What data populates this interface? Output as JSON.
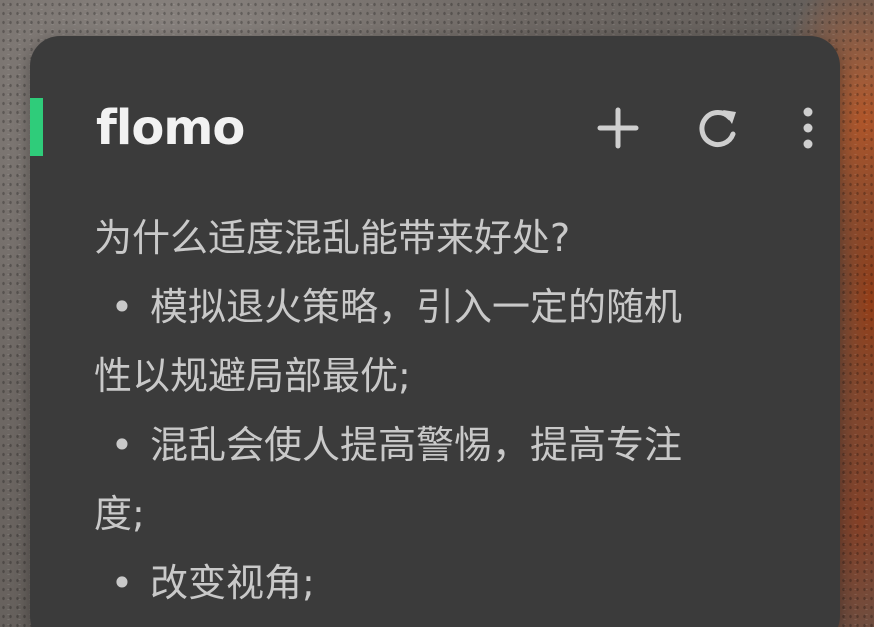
{
  "app": {
    "title": "flomo",
    "accent_color": "#2fcc7a",
    "card_color": "#3b3b3b"
  },
  "toolbar": {
    "add_icon": "plus-icon",
    "refresh_icon": "refresh-icon",
    "more_icon": "more-vertical-icon"
  },
  "memo": {
    "lines": [
      {
        "bullet": "",
        "text": "为什么适度混乱能带来好处?"
      },
      {
        "bullet": "•",
        "text": "模拟退火策略，引入一定的随机"
      },
      {
        "bullet": "",
        "text": "性以规避局部最优;"
      },
      {
        "bullet": "•",
        "text": "混乱会使人提高警惕，提高专注"
      },
      {
        "bullet": "",
        "text": "度;"
      },
      {
        "bullet": "•",
        "text": "改变视角;"
      }
    ]
  }
}
